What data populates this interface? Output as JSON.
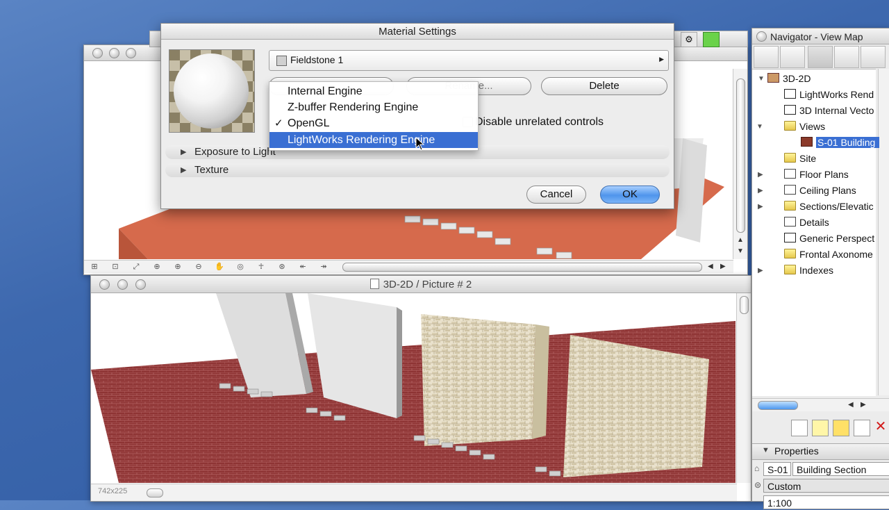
{
  "dialog": {
    "title": "Material Settings",
    "material_name": "Fieldstone 1",
    "rename_button": "Rename...",
    "delete_button": "Delete",
    "disable_unrelated": "Disable unrelated controls",
    "sections": [
      "Exposure to Light",
      "Texture"
    ],
    "cancel_button": "Cancel",
    "ok_button": "OK"
  },
  "engine_menu": {
    "items": [
      {
        "label": "Internal Engine",
        "checked": false,
        "selected": false
      },
      {
        "label": "Z-buffer Rendering Engine",
        "checked": false,
        "selected": false
      },
      {
        "label": "OpenGL",
        "checked": true,
        "selected": false
      },
      {
        "label": "LightWorks Rendering Engine",
        "checked": false,
        "selected": true
      }
    ],
    "check_glyph": "✓"
  },
  "picture_window": {
    "title": "3D-2D / Picture # 2",
    "size_readout": "742x225"
  },
  "navigator": {
    "title": "Navigator - View Map",
    "tree": [
      {
        "label": "3D-2D",
        "level": 0,
        "disclosure": "open",
        "icon": "house-icon"
      },
      {
        "label": "LightWorks Rend",
        "level": 1,
        "disclosure": "",
        "icon": "camera-icon"
      },
      {
        "label": "3D Internal Vecto",
        "level": 1,
        "disclosure": "",
        "icon": "camera-icon"
      },
      {
        "label": "Views",
        "level": 1,
        "disclosure": "open",
        "icon": "folder-icon"
      },
      {
        "label": "S-01 Building",
        "level": 2,
        "disclosure": "",
        "icon": "section-icon",
        "selected": true
      },
      {
        "label": "Site",
        "level": 1,
        "disclosure": "",
        "icon": "folder-icon"
      },
      {
        "label": "Floor Plans",
        "level": 1,
        "disclosure": "closed",
        "icon": "plan-icon"
      },
      {
        "label": "Ceiling Plans",
        "level": 1,
        "disclosure": "closed",
        "icon": "plan-icon"
      },
      {
        "label": "Sections/Elevatic",
        "level": 1,
        "disclosure": "closed",
        "icon": "section-icon"
      },
      {
        "label": "Details",
        "level": 1,
        "disclosure": "",
        "icon": "detail-icon"
      },
      {
        "label": "Generic Perspect",
        "level": 1,
        "disclosure": "",
        "icon": "camera-icon"
      },
      {
        "label": "Frontal Axonome",
        "level": 1,
        "disclosure": "",
        "icon": "axon-icon"
      },
      {
        "label": "Indexes",
        "level": 1,
        "disclosure": "closed",
        "icon": "folder-icon"
      }
    ],
    "properties_label": "Properties",
    "prop_id": "S-01",
    "prop_name": "Building Section",
    "prop_custom": "Custom",
    "prop_scale": "1:100"
  },
  "colors": {
    "selection": "#3a6fd3",
    "desktop": "#3d68ae",
    "brick": "#8c2f2f",
    "floor_orange": "#d46a4a"
  }
}
